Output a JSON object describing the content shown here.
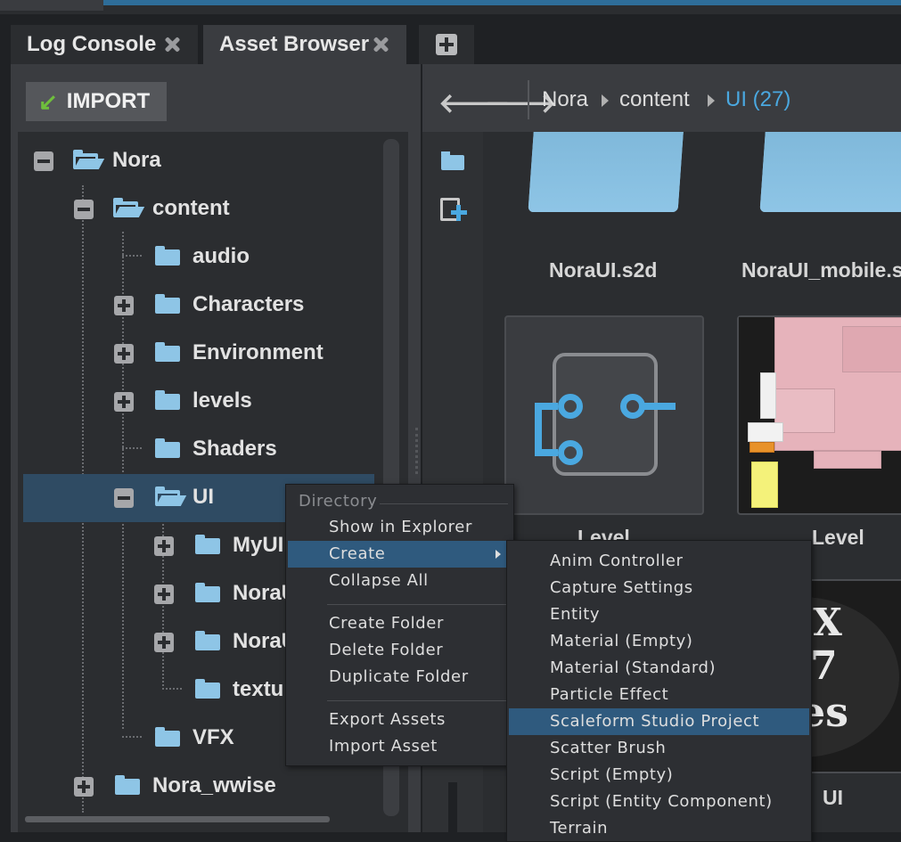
{
  "tabs": [
    {
      "label": "Log Console"
    },
    {
      "label": "Asset Browser"
    }
  ],
  "import_button": {
    "label": "IMPORT"
  },
  "tree": {
    "items": [
      {
        "label": "Nora"
      },
      {
        "label": "content"
      },
      {
        "label": "audio"
      },
      {
        "label": "Characters"
      },
      {
        "label": "Environment"
      },
      {
        "label": "levels"
      },
      {
        "label": "Shaders"
      },
      {
        "label": "UI"
      },
      {
        "label": "MyUI"
      },
      {
        "label": "NoraU"
      },
      {
        "label": "NoraU"
      },
      {
        "label": "textu"
      },
      {
        "label": "VFX"
      },
      {
        "label": "Nora_wwise"
      }
    ]
  },
  "breadcrumb": {
    "items": [
      "Nora",
      "content"
    ],
    "current": "UI (27)"
  },
  "assets": [
    {
      "label": "NoraUI.s2d"
    },
    {
      "label": "NoraUI_mobile.s"
    },
    {
      "label": "Level"
    },
    {
      "label": "Level"
    },
    {
      "label": "UI"
    }
  ],
  "thumb_text": {
    "line1": "TEX",
    "line2": "7",
    "line3": "kes"
  },
  "context_menu": {
    "header": "Directory",
    "group1": [
      "Show in Explorer",
      "Create",
      "Collapse All"
    ],
    "group2": [
      "Create Folder",
      "Delete Folder",
      "Duplicate Folder"
    ],
    "group3": [
      "Export Assets",
      "Import Asset"
    ]
  },
  "create_submenu": {
    "items": [
      "Anim Controller",
      "Capture Settings",
      "Entity",
      "Material (Empty)",
      "Material (Standard)",
      "Particle Effect",
      "Scaleform Studio Project",
      "Scatter Brush",
      "Script (Empty)",
      "Script (Entity Component)",
      "Terrain"
    ]
  },
  "colors": {
    "accent": "#4aa8e0",
    "selection": "#2f4b63",
    "menu_highlight": "#2f5a7e",
    "folder": "#8ec5e6",
    "import_arrow": "#6fbf3c"
  }
}
